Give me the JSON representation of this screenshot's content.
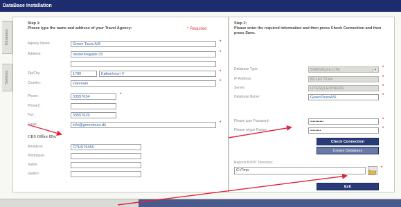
{
  "window": {
    "title": "DataBase Installation"
  },
  "side_tabs": [
    "Database",
    "Settings"
  ],
  "step1": {
    "heading": "Step 1:",
    "instructions": "Please type the name and address of your Travel Agency:",
    "required_label": "* Required",
    "fields": {
      "agency_name": {
        "label": "Agency Name:",
        "value": "Green Tours A/S"
      },
      "address": {
        "label": "Address:",
        "value": "Vesterbrogade 33"
      },
      "zip": {
        "label": "Zip/City:",
        "value": "1780"
      },
      "city": {
        "value": "København V"
      },
      "country": {
        "label": "Country:",
        "value": "Danmark"
      },
      "phone": {
        "label": "Phone:",
        "value": "33557634"
      },
      "phone2": {
        "label": "Phone2:",
        "value": ""
      },
      "fax": {
        "label": "Fax:",
        "value": "33557629"
      },
      "email": {
        "label": "Email:",
        "value": "info@greentours.dk"
      }
    },
    "crs": {
      "title": "CRS Office IDs:",
      "fields": {
        "amadeus": {
          "label": "Amadeus:",
          "value": "CPHS76456"
        },
        "worldspan": {
          "label": "Worldspan:",
          "value": ""
        },
        "sabre": {
          "label": "Sabre:",
          "value": ""
        },
        "galileo": {
          "label": "Galileo:",
          "value": ""
        }
      }
    }
  },
  "step2": {
    "heading": "Step 2:",
    "instructions": "Please enter the required information and then press Check Connection and then press Save.",
    "fields": {
      "db_type": {
        "label": "Database Type:",
        "value": "SoftSolCore LITE"
      },
      "ip": {
        "label": "IP Address:",
        "value": "83.162.79.84"
      },
      "server": {
        "label": "Server:",
        "value": "LITESQLEXPRESS"
      },
      "db_name": {
        "label": "Database Name:",
        "value": "GreenToursA/S"
      },
      "password": {
        "label": "Please type Password:",
        "value": "••••••••••"
      },
      "password2": {
        "label": "Please retype Passw",
        "value": "••••••••"
      },
      "reports_dir": {
        "label": "Reports ROOT Directory:",
        "value": "C:\\Tmp"
      }
    },
    "check_button": "Check Connection",
    "create_button": "Create Database",
    "exit_button": "Exit"
  },
  "colors": {
    "titlebar": "#1c2c6c",
    "accent_button": "#2a3c78",
    "required": "#d6453c",
    "value_text": "#2e64a8",
    "annotation_arrow": "#e0243c"
  },
  "icons": {
    "folder": "folder-icon",
    "dropdown": "chevron-down-icon",
    "required": "asterisk-icon"
  }
}
